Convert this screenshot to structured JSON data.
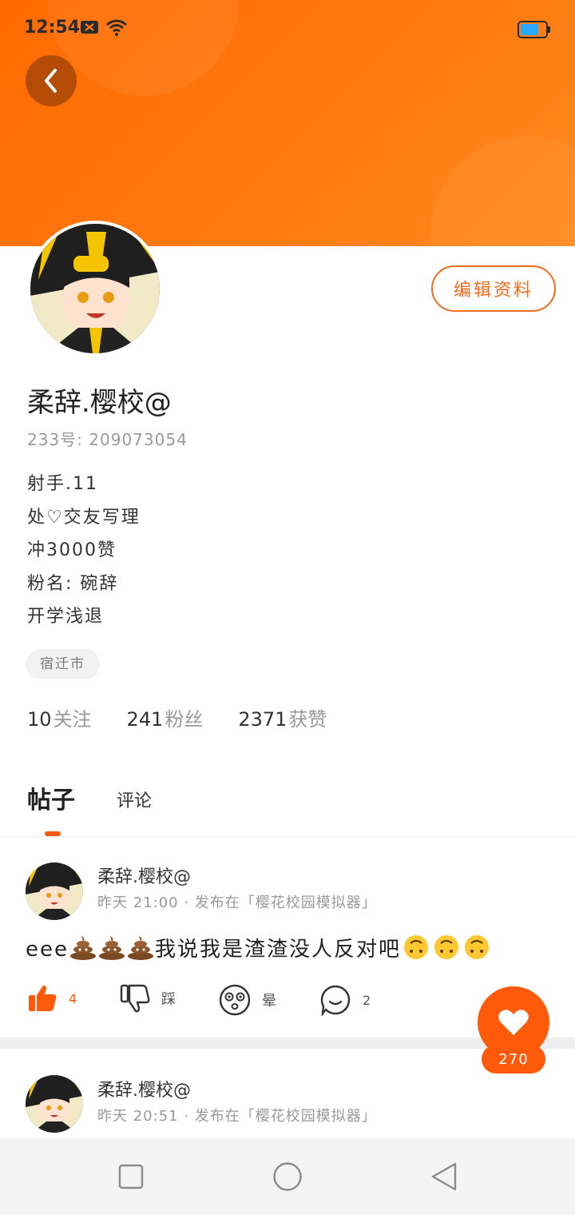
{
  "status_bar": {
    "time": "12:54"
  },
  "profile": {
    "edit_button": "编辑资料",
    "name": "柔辞.樱校@",
    "uid": "233号:  209073054",
    "bio": [
      "射手.11",
      "处♡交友写理",
      "冲3000赞",
      "粉名:  碗辞",
      "开学浅退"
    ],
    "location": "宿迁市",
    "stats": [
      {
        "num": "10",
        "label": "关注"
      },
      {
        "num": "241",
        "label": "粉丝"
      },
      {
        "num": "2371",
        "label": "获赞"
      }
    ]
  },
  "tabs": {
    "posts": "帖子",
    "comments": "评论"
  },
  "posts": [
    {
      "author": "柔辞.樱校@",
      "meta": "昨天 21:00 · 发布在「樱花校园模拟器」",
      "text_prefix": "eee",
      "text_middle": "我说我是渣渣没人反对吧",
      "likes": "4",
      "dislike_label": "踩",
      "dizzy_label": "晕",
      "comments": "2"
    },
    {
      "author": "柔辞.樱校@",
      "meta": "昨天 20:51 · 发布在「樱花校园模拟器」"
    }
  ],
  "fab": {
    "count": "270"
  },
  "colors": {
    "accent": "#ff6a00",
    "like": "#ff5a0a"
  },
  "icons": [
    "back-icon",
    "heart-icon",
    "thumbs-up-icon",
    "thumbs-down-icon",
    "dizzy-icon",
    "comment-icon",
    "poop-emoji",
    "upside-down-face-emoji"
  ]
}
